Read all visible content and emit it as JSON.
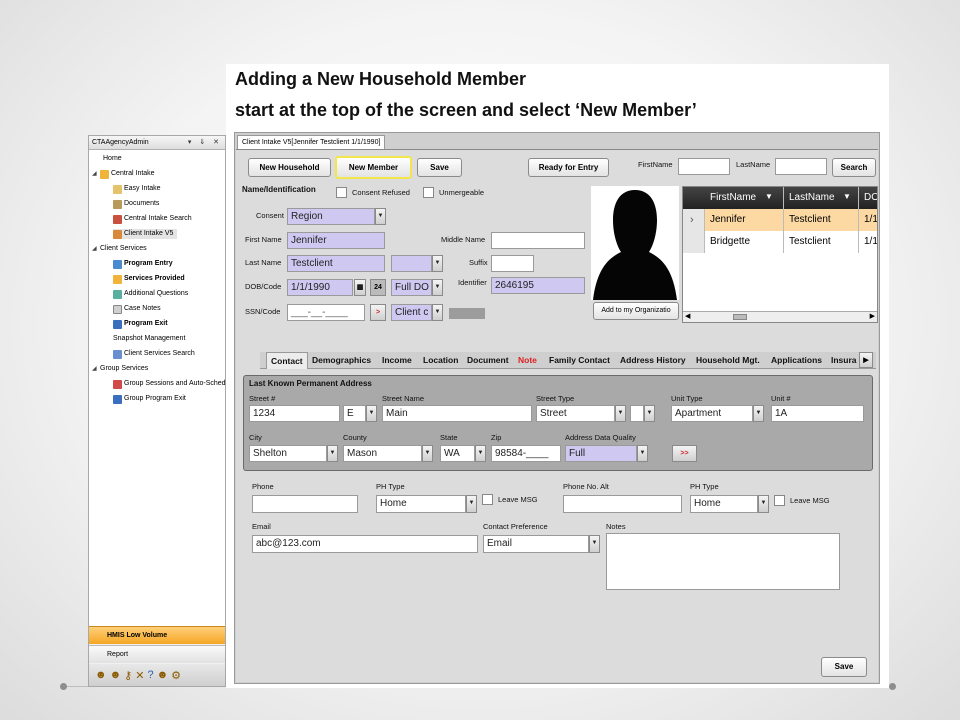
{
  "slide": {
    "title_line1": "Adding a New Household Member",
    "title_line2": "start at the top of the screen and select ‘New Member’"
  },
  "tree": {
    "header": "CTAAgencyAdmin",
    "header_controls": "▾ ⇓ ✕",
    "items": [
      {
        "label": "Home",
        "bold": false
      },
      {
        "label": "Central Intake",
        "bold": false
      },
      {
        "label": "Easy Intake",
        "bold": false
      },
      {
        "label": "Documents",
        "bold": false
      },
      {
        "label": "Central Intake Search",
        "bold": false
      },
      {
        "label": "Client Intake V5",
        "bold": false
      },
      {
        "label": "Client Services",
        "bold": false
      },
      {
        "label": "Program Entry",
        "bold": true
      },
      {
        "label": "Services Provided",
        "bold": true
      },
      {
        "label": "Additional Questions",
        "bold": false
      },
      {
        "label": "Case Notes",
        "bold": false
      },
      {
        "label": "Program Exit",
        "bold": true
      },
      {
        "label": "Snapshot Management",
        "bold": false
      },
      {
        "label": "Client Services Search",
        "bold": false
      },
      {
        "label": "Group Services",
        "bold": false
      },
      {
        "label": "Group Sessions and Auto-Sched",
        "bold": false
      },
      {
        "label": "Group Program Exit",
        "bold": false
      }
    ],
    "bottom": {
      "hmis": "HMIS Low Volume",
      "report": "Report"
    }
  },
  "app": {
    "tab_title": "Client Intake V5[Jennifer Testclient 1/1/1990]",
    "buttons": {
      "new_household": "New Household",
      "new_member": "New Member",
      "save": "Save",
      "ready": "Ready for Entry",
      "search": "Search",
      "add_org": "Add to my Organizatio",
      "addr_go": ">>",
      "ssn_go": ">",
      "save_bottom": "Save"
    },
    "search": {
      "first_label": "FirstName",
      "last_label": "LastName"
    },
    "name_section": {
      "title": "Name/Identification",
      "consent_refused": "Consent Refused",
      "unmergeable": "Unmergeable",
      "consent_label": "Consent",
      "consent_value": "Region",
      "first_label": "First Name",
      "first_value": "Jennifer",
      "middle_label": "Middle Name",
      "last_label": "Last Name",
      "last_value": "Testclient",
      "suffix_label": "Suffix",
      "dob_label": "DOB/Code",
      "dob_value": "1/1/1990",
      "dob_cal": "24",
      "dob_code": "Full DO",
      "identifier_label": "Identifier",
      "identifier_value": "2646195",
      "ssn_label": "SSN/Code",
      "ssn_value": "___-__-____",
      "ssn_code": "Client c"
    },
    "grid": {
      "columns": [
        "FirstName",
        "LastName",
        "DO"
      ],
      "rows": [
        {
          "first": "Jennifer",
          "last": "Testclient",
          "dob": "1/1"
        },
        {
          "first": "Bridgette",
          "last": "Testclient",
          "dob": "1/1"
        }
      ]
    },
    "tabs": [
      "Contact",
      "Demographics",
      "Income",
      "Location",
      "Document",
      "Note",
      "Family Contact",
      "Address History",
      "Household Mgt.",
      "Applications",
      "Insura"
    ],
    "address": {
      "title": "Last Known Permanent Address",
      "street_num_label": "Street #",
      "street_num": "1234",
      "dir": "E",
      "street_name_label": "Street Name",
      "street_name": "Main",
      "street_type_label": "Street Type",
      "street_type": "Street",
      "unit_type_label": "Unit Type",
      "unit_type": "Apartment",
      "unit_num_label": "Unit #",
      "unit_num": "1A",
      "city_label": "City",
      "city": "Shelton",
      "county_label": "County",
      "county": "Mason",
      "state_label": "State",
      "state": "WA",
      "zip_label": "Zip",
      "zip": "98584-____",
      "quality_label": "Address Data Quality",
      "quality": "Full"
    },
    "contact": {
      "phone_label": "Phone",
      "ph_type_label": "PH Type",
      "ph_type": "Home",
      "leave_msg": "Leave MSG",
      "phone_alt_label": "Phone No. Alt",
      "ph_type2_label": "PH Type",
      "ph_type2": "Home",
      "leave_msg2": "Leave MSG",
      "email_label": "Email",
      "email": "abc@123.com",
      "contact_pref_label": "Contact Preference",
      "contact_pref": "Email",
      "notes_label": "Notes"
    }
  }
}
